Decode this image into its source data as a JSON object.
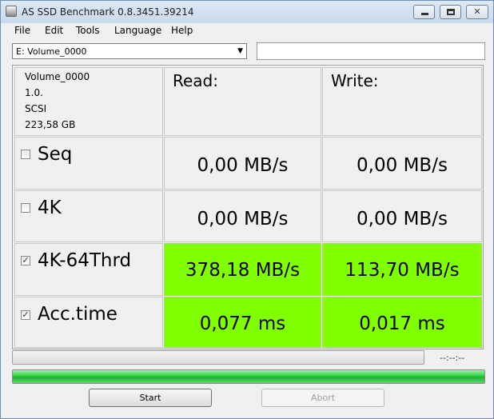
{
  "window": {
    "title": "AS SSD Benchmark 0.8.3451.39214"
  },
  "menu": [
    "File",
    "Edit",
    "Tools",
    "Language",
    "Help"
  ],
  "drive_select": {
    "value": "E: Volume_0000"
  },
  "side_field": {
    "value": ""
  },
  "drive_info": [
    "Volume_0000",
    "1.0.",
    "SCSI",
    "223,58 GB"
  ],
  "headers": {
    "read": "Read:",
    "write": "Write:"
  },
  "tests": [
    {
      "label": "Seq",
      "checked": false,
      "read": "0,00 MB/s",
      "write": "0,00 MB/s",
      "highlight": false
    },
    {
      "label": "4K",
      "checked": false,
      "read": "0,00 MB/s",
      "write": "0,00 MB/s",
      "highlight": false
    },
    {
      "label": "4K-64Thrd",
      "checked": true,
      "read": "378,18 MB/s",
      "write": "113,70 MB/s",
      "highlight": true
    },
    {
      "label": "Acc.time",
      "checked": true,
      "read": "0,077 ms",
      "write": "0,017 ms",
      "highlight": true
    }
  ],
  "progress": {
    "elapsed": "--:--:--",
    "main_fraction": 0,
    "overall_fraction": 1.0
  },
  "buttons": {
    "start": "Start",
    "abort": "Abort"
  },
  "colors": {
    "result_highlight": "#80ff00",
    "progress_green": "#2bd13f"
  }
}
